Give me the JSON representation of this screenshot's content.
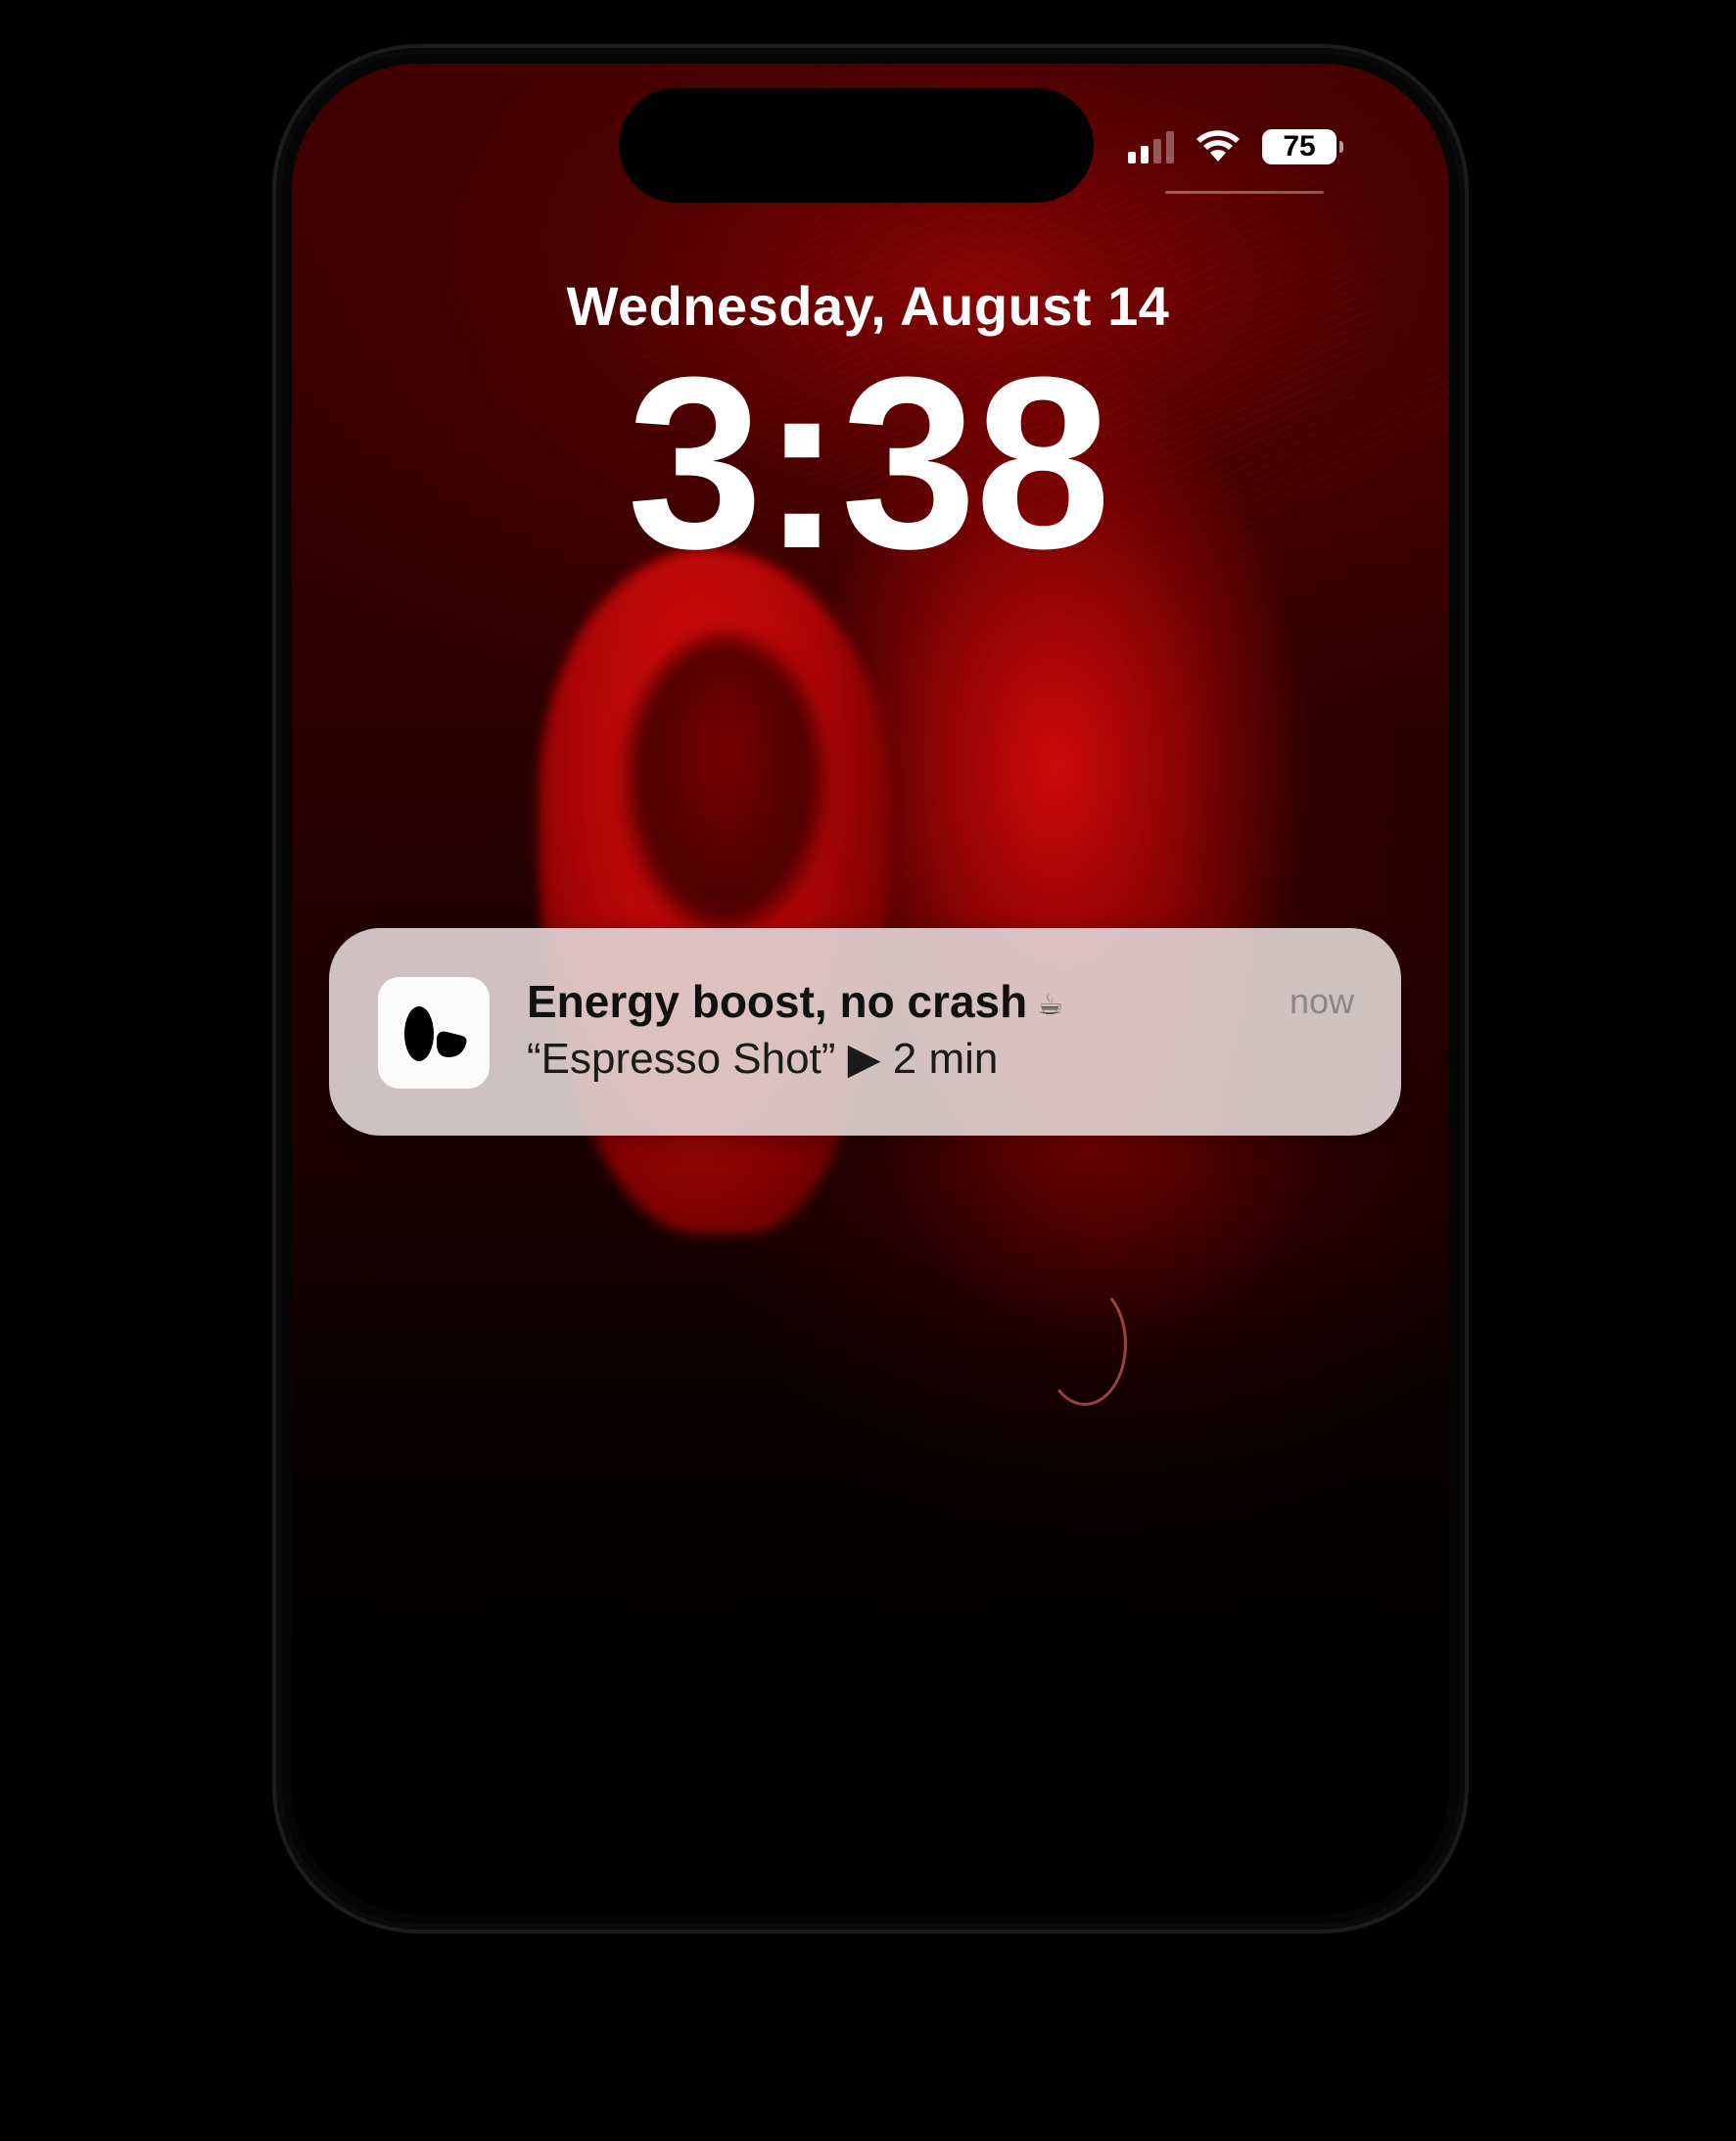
{
  "status_bar": {
    "battery_level": "75",
    "signal_bars_active": 2,
    "signal_bars_total": 4,
    "icons": [
      "cellular-signal-icon",
      "wifi-icon",
      "battery-icon"
    ]
  },
  "lock_screen": {
    "date": "Wednesday, August 14",
    "time": "3:38"
  },
  "notification": {
    "app_icon": "app-logo-icon",
    "title": "Energy boost, no crash",
    "title_emoji": "☕",
    "body": "“Espresso Shot” ▶ 2 min",
    "timestamp": "now"
  },
  "colors": {
    "wallpaper_red": "#c40606",
    "notification_bg": "#e2d6d6",
    "text_primary": "#ffffff"
  }
}
